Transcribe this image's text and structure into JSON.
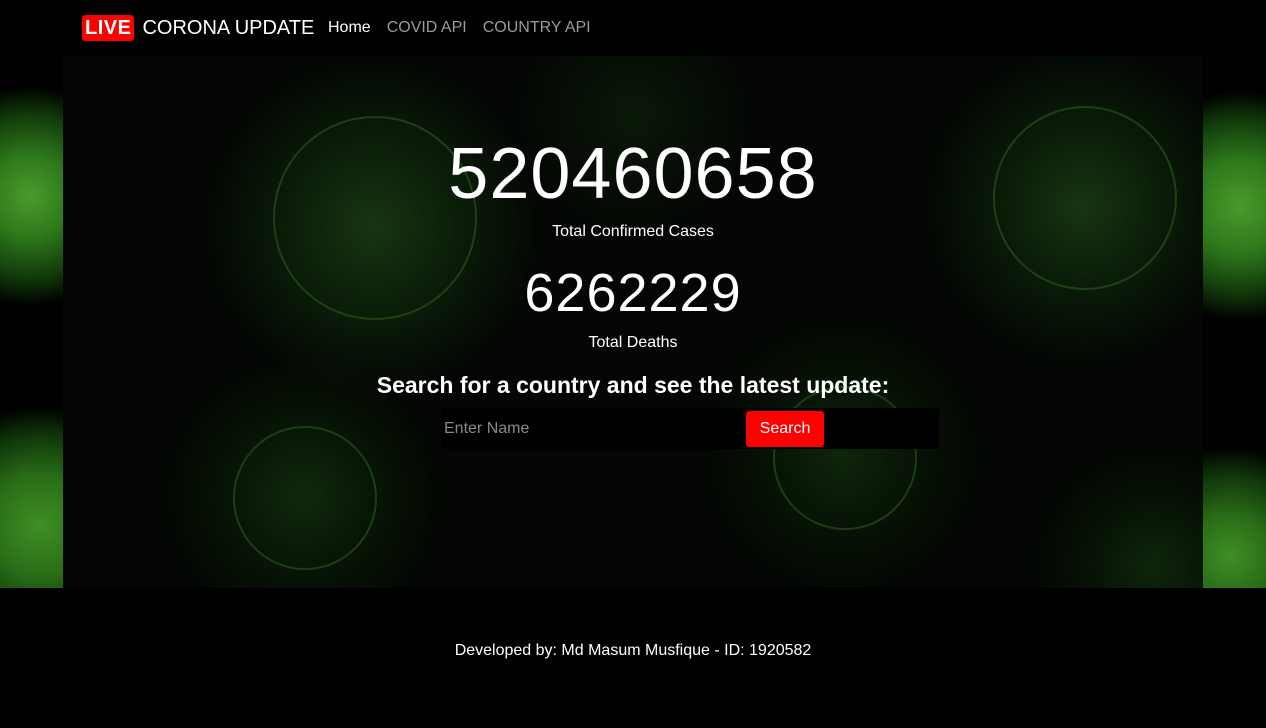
{
  "navbar": {
    "live_badge": "LIVE",
    "brand_text": "CORONA UPDATE",
    "links": [
      {
        "label": "Home",
        "active": true
      },
      {
        "label": "COVID API",
        "active": false
      },
      {
        "label": "COUNTRY API",
        "active": false
      }
    ]
  },
  "stats": {
    "confirmed_value": "520460658",
    "confirmed_label": "Total Confirmed Cases",
    "deaths_value": "6262229",
    "deaths_label": "Total Deaths"
  },
  "search": {
    "heading": "Search for a country and see the latest update:",
    "placeholder": "Enter Name",
    "value": "",
    "button_label": "Search"
  },
  "footer": {
    "text": "Developed by: Md Masum Musfique - ID: 1920582"
  },
  "colors": {
    "accent": "#ff0000",
    "background": "#000000",
    "nav_inactive": "#9a9a9a",
    "virus_green": "#3f8f24"
  }
}
